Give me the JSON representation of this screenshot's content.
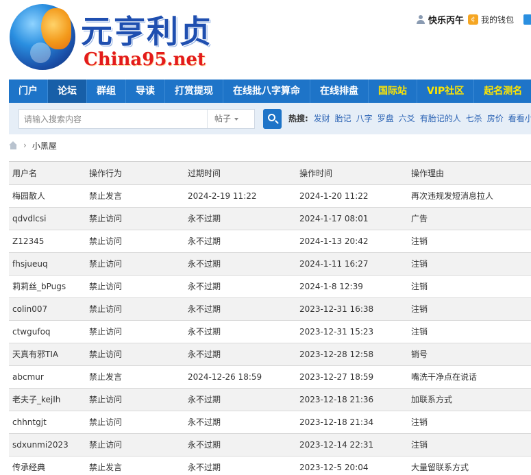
{
  "site": {
    "logo_cn": "元亨利贞",
    "logo_en": "China95.net"
  },
  "user": {
    "name": "快乐丙午",
    "wallet_label": "我的钱包"
  },
  "nav": {
    "items": [
      {
        "label": "门户",
        "active": false,
        "highlight": false
      },
      {
        "label": "论坛",
        "active": true,
        "highlight": false
      },
      {
        "label": "群组",
        "active": false,
        "highlight": false
      },
      {
        "label": "导读",
        "active": false,
        "highlight": false
      },
      {
        "label": "打赏提现",
        "active": false,
        "highlight": false
      },
      {
        "label": "在线批八字算命",
        "active": false,
        "highlight": false
      },
      {
        "label": "在线排盘",
        "active": false,
        "highlight": false
      },
      {
        "label": "国际站",
        "active": false,
        "highlight": true
      },
      {
        "label": "VIP社区",
        "active": false,
        "highlight": true
      },
      {
        "label": "起名测名",
        "active": false,
        "highlight": true
      }
    ]
  },
  "search": {
    "placeholder": "请输入搜索内容",
    "type_label": "帖子",
    "hot_label": "热搜:",
    "hot_items": [
      "发财",
      "胎记",
      "八字",
      "罗盘",
      "六爻",
      "有胎记的人",
      "七杀",
      "房价",
      "看看小"
    ]
  },
  "breadcrumb": {
    "current": "小黑屋"
  },
  "table": {
    "headers": [
      "用户名",
      "操作行为",
      "过期时间",
      "操作时间",
      "操作理由"
    ],
    "rows": [
      [
        "梅园散人",
        "禁止发言",
        "2024-2-19 11:22",
        "2024-1-20 11:22",
        "再次违规发短消息拉人"
      ],
      [
        "qdvdlcsi",
        "禁止访问",
        "永不过期",
        "2024-1-17 08:01",
        "广告"
      ],
      [
        "Z12345",
        "禁止访问",
        "永不过期",
        "2024-1-13 20:42",
        "注销"
      ],
      [
        "fhsjueuq",
        "禁止访问",
        "永不过期",
        "2024-1-11 16:27",
        "注销"
      ],
      [
        "莉莉丝_bPugs",
        "禁止访问",
        "永不过期",
        "2024-1-8 12:39",
        "注销"
      ],
      [
        "colin007",
        "禁止访问",
        "永不过期",
        "2023-12-31 16:38",
        "注销"
      ],
      [
        "ctwgufoq",
        "禁止访问",
        "永不过期",
        "2023-12-31 15:23",
        "注销"
      ],
      [
        "天真有邪TIA",
        "禁止访问",
        "永不过期",
        "2023-12-28 12:58",
        "销号"
      ],
      [
        "abcmur",
        "禁止发言",
        "2024-12-26 18:59",
        "2023-12-27 18:59",
        "嘴洗干净点在说话"
      ],
      [
        "老夫子_kejIh",
        "禁止访问",
        "永不过期",
        "2023-12-18 21:36",
        "加联系方式"
      ],
      [
        "chhntgjt",
        "禁止访问",
        "永不过期",
        "2023-12-18 21:34",
        "注销"
      ],
      [
        "sdxunmi2023",
        "禁止访问",
        "永不过期",
        "2023-12-14 22:31",
        "注销"
      ],
      [
        "传承经典",
        "禁止发言",
        "永不过期",
        "2023-12-5 20:04",
        "大量留联系方式"
      ]
    ]
  }
}
